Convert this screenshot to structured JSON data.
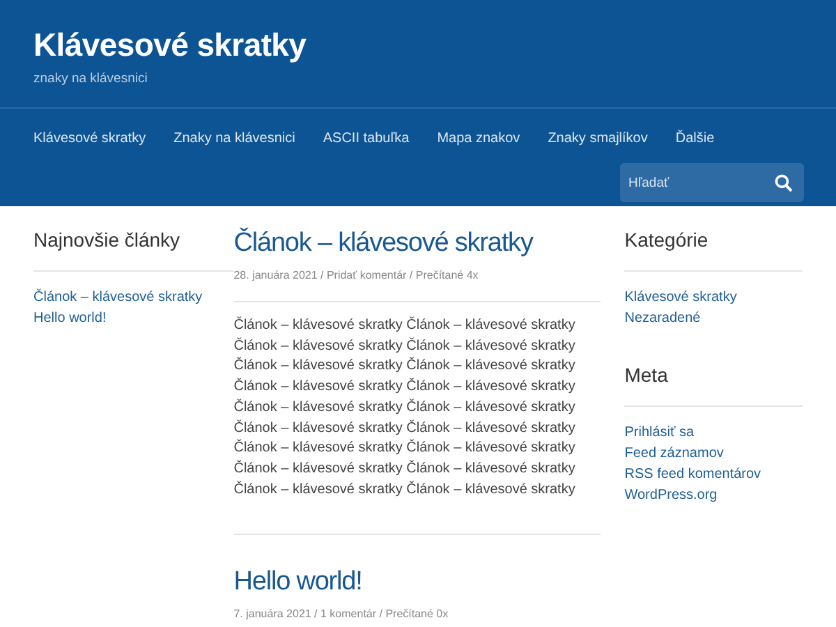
{
  "site": {
    "title": "Klávesové skratky",
    "tagline": "znaky na klávesnici"
  },
  "nav": [
    {
      "label": "Klávesové skratky"
    },
    {
      "label": "Znaky na klávesnici"
    },
    {
      "label": "ASCII tabuľka"
    },
    {
      "label": "Mapa znakov"
    },
    {
      "label": "Znaky smajlíkov"
    },
    {
      "label": "Ďalšie"
    }
  ],
  "search": {
    "placeholder": "Hľadať"
  },
  "left_widget": {
    "title": "Najnovšie články",
    "links": [
      "Článok – klávesové skratky",
      "Hello world!"
    ]
  },
  "posts": [
    {
      "title": "Článok – klávesové skratky",
      "meta": "28. januára 2021 / Pridať komentár / Prečítané 4x",
      "lines": [
        "Článok – klávesové skratky Článok – klávesové skratky",
        "Článok – klávesové skratky Článok – klávesové skratky",
        "Článok – klávesové skratky Článok – klávesové skratky",
        "Článok – klávesové skratky Článok – klávesové skratky",
        "Článok – klávesové skratky Článok – klávesové skratky",
        "Článok – klávesové skratky Článok – klávesové skratky",
        "Článok – klávesové skratky Článok – klávesové skratky",
        "Článok – klávesové skratky Článok – klávesové skratky",
        "Článok – klávesové skratky Článok – klávesové skratky"
      ]
    },
    {
      "title": "Hello world!",
      "meta": "7. januára 2021 / 1 komentár / Prečítané 0x"
    }
  ],
  "right_widgets": [
    {
      "title": "Kategórie",
      "links": [
        "Klávesové skratky",
        "Nezaradené"
      ]
    },
    {
      "title": "Meta",
      "links": [
        "Prihlásiť sa",
        "Feed záznamov",
        "RSS feed komentárov",
        "WordPress.org"
      ]
    }
  ]
}
